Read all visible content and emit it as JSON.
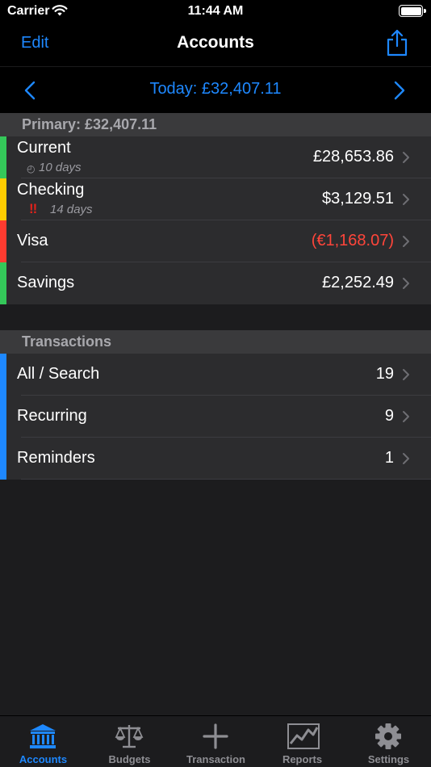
{
  "status_bar": {
    "carrier": "Carrier",
    "time": "11:44 AM"
  },
  "nav": {
    "edit_label": "Edit",
    "title": "Accounts"
  },
  "date_bar": {
    "label": "Today: £32,407.11"
  },
  "primary": {
    "header": "Primary: £32,407.11",
    "accounts": [
      {
        "name": "Current",
        "sub": "10 days",
        "value": "£28,653.86",
        "color": "#34c759"
      },
      {
        "name": "Checking",
        "sub": "14 days",
        "warning": "!!",
        "value": "$3,129.51",
        "color": "#ffcc00"
      },
      {
        "name": "Visa",
        "value": "(€1,168.07)",
        "color": "#ff3b30",
        "negative": true
      },
      {
        "name": "Savings",
        "value": "£2,252.49",
        "color": "#34c759"
      }
    ]
  },
  "transactions": {
    "header": "Transactions",
    "items": [
      {
        "name": "All / Search",
        "count": "19",
        "color": "#1e88ff"
      },
      {
        "name": "Recurring",
        "count": "9",
        "color": "#1e88ff"
      },
      {
        "name": "Reminders",
        "count": "1",
        "color": "#1e88ff"
      }
    ]
  },
  "tabs": [
    {
      "label": "Accounts",
      "icon": "bank-icon",
      "active": true
    },
    {
      "label": "Budgets",
      "icon": "scales-icon"
    },
    {
      "label": "Transaction",
      "icon": "plus-icon"
    },
    {
      "label": "Reports",
      "icon": "chart-icon"
    },
    {
      "label": "Settings",
      "icon": "gear-icon"
    }
  ],
  "colors": {
    "accent": "#1e88ff",
    "negative": "#ff453a",
    "background": "#1c1c1e"
  }
}
